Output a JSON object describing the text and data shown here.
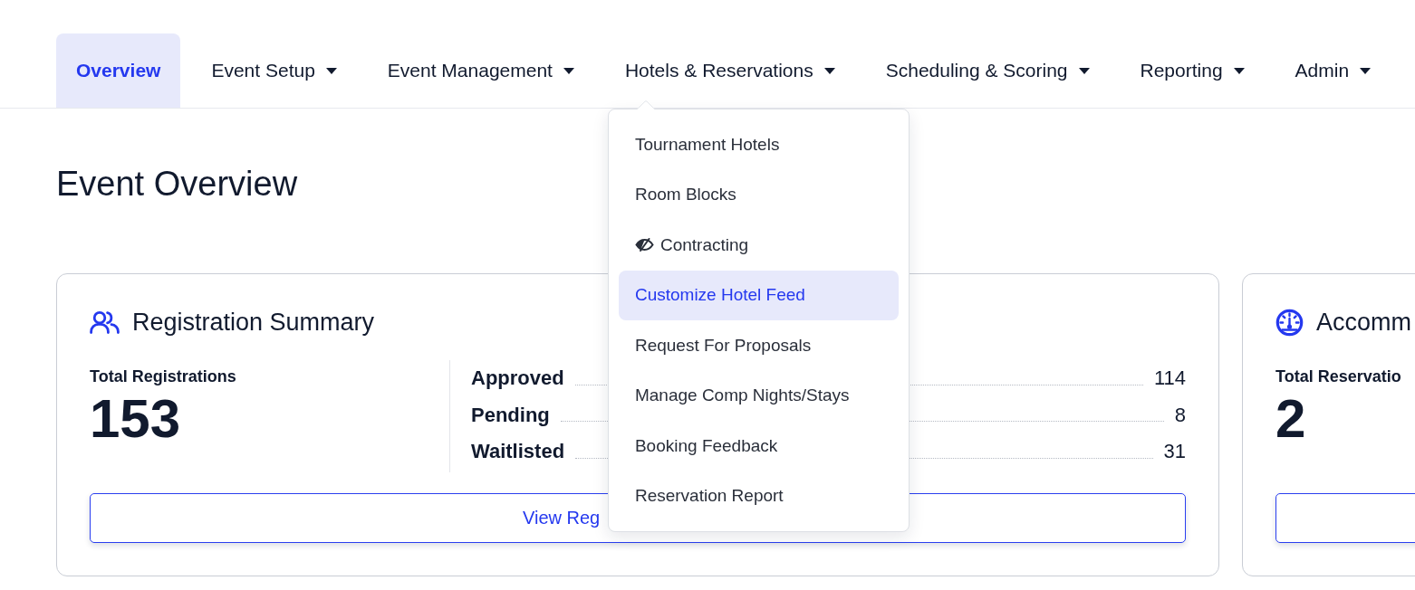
{
  "nav": {
    "tabs": [
      {
        "label": "Overview",
        "selected": true,
        "has_dropdown": false,
        "expanded": false
      },
      {
        "label": "Event Setup",
        "selected": false,
        "has_dropdown": true,
        "expanded": false
      },
      {
        "label": "Event Management",
        "selected": false,
        "has_dropdown": true,
        "expanded": false
      },
      {
        "label": "Hotels & Reservations",
        "selected": false,
        "has_dropdown": true,
        "expanded": true,
        "menu": [
          {
            "label": "Tournament Hotels",
            "kind": "plain",
            "selected": false
          },
          {
            "label": "Room Blocks",
            "kind": "plain",
            "selected": false
          },
          {
            "label": "Contracting",
            "kind": "icon",
            "selected": false
          },
          {
            "label": "Customize Hotel Feed",
            "kind": "plain",
            "selected": true
          },
          {
            "label": "Request For Proposals",
            "kind": "plain",
            "selected": false
          },
          {
            "label": "Manage Comp Nights/Stays",
            "kind": "plain",
            "selected": false
          },
          {
            "label": "Booking Feedback",
            "kind": "plain",
            "selected": false
          },
          {
            "label": "Reservation Report",
            "kind": "plain",
            "selected": false
          }
        ]
      },
      {
        "label": "Scheduling & Scoring",
        "selected": false,
        "has_dropdown": true,
        "expanded": false
      },
      {
        "label": "Reporting",
        "selected": false,
        "has_dropdown": true,
        "expanded": false
      },
      {
        "label": "Admin",
        "selected": false,
        "has_dropdown": true,
        "expanded": false
      }
    ]
  },
  "page_title": "Event Overview",
  "cards": [
    {
      "title": "Registration Summary",
      "total_label": "Total Registrations",
      "total_value": "153",
      "breakdown": [
        {
          "label": "Approved",
          "value": "114"
        },
        {
          "label": "Pending",
          "value": "8"
        },
        {
          "label": "Waitlisted",
          "value": "31"
        }
      ],
      "button_label": "View Reg"
    },
    {
      "title": "Accomm",
      "total_label": "Total Reservatio",
      "total_value": "2"
    }
  ]
}
